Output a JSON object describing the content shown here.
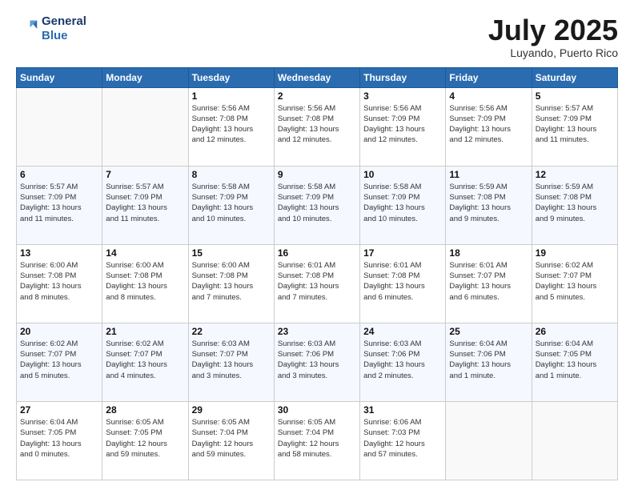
{
  "header": {
    "logo_line1": "General",
    "logo_line2": "Blue",
    "month": "July 2025",
    "location": "Luyando, Puerto Rico"
  },
  "weekdays": [
    "Sunday",
    "Monday",
    "Tuesday",
    "Wednesday",
    "Thursday",
    "Friday",
    "Saturday"
  ],
  "weeks": [
    [
      {
        "day": "",
        "info": ""
      },
      {
        "day": "",
        "info": ""
      },
      {
        "day": "1",
        "info": "Sunrise: 5:56 AM\nSunset: 7:08 PM\nDaylight: 13 hours\nand 12 minutes."
      },
      {
        "day": "2",
        "info": "Sunrise: 5:56 AM\nSunset: 7:08 PM\nDaylight: 13 hours\nand 12 minutes."
      },
      {
        "day": "3",
        "info": "Sunrise: 5:56 AM\nSunset: 7:09 PM\nDaylight: 13 hours\nand 12 minutes."
      },
      {
        "day": "4",
        "info": "Sunrise: 5:56 AM\nSunset: 7:09 PM\nDaylight: 13 hours\nand 12 minutes."
      },
      {
        "day": "5",
        "info": "Sunrise: 5:57 AM\nSunset: 7:09 PM\nDaylight: 13 hours\nand 11 minutes."
      }
    ],
    [
      {
        "day": "6",
        "info": "Sunrise: 5:57 AM\nSunset: 7:09 PM\nDaylight: 13 hours\nand 11 minutes."
      },
      {
        "day": "7",
        "info": "Sunrise: 5:57 AM\nSunset: 7:09 PM\nDaylight: 13 hours\nand 11 minutes."
      },
      {
        "day": "8",
        "info": "Sunrise: 5:58 AM\nSunset: 7:09 PM\nDaylight: 13 hours\nand 10 minutes."
      },
      {
        "day": "9",
        "info": "Sunrise: 5:58 AM\nSunset: 7:09 PM\nDaylight: 13 hours\nand 10 minutes."
      },
      {
        "day": "10",
        "info": "Sunrise: 5:58 AM\nSunset: 7:09 PM\nDaylight: 13 hours\nand 10 minutes."
      },
      {
        "day": "11",
        "info": "Sunrise: 5:59 AM\nSunset: 7:08 PM\nDaylight: 13 hours\nand 9 minutes."
      },
      {
        "day": "12",
        "info": "Sunrise: 5:59 AM\nSunset: 7:08 PM\nDaylight: 13 hours\nand 9 minutes."
      }
    ],
    [
      {
        "day": "13",
        "info": "Sunrise: 6:00 AM\nSunset: 7:08 PM\nDaylight: 13 hours\nand 8 minutes."
      },
      {
        "day": "14",
        "info": "Sunrise: 6:00 AM\nSunset: 7:08 PM\nDaylight: 13 hours\nand 8 minutes."
      },
      {
        "day": "15",
        "info": "Sunrise: 6:00 AM\nSunset: 7:08 PM\nDaylight: 13 hours\nand 7 minutes."
      },
      {
        "day": "16",
        "info": "Sunrise: 6:01 AM\nSunset: 7:08 PM\nDaylight: 13 hours\nand 7 minutes."
      },
      {
        "day": "17",
        "info": "Sunrise: 6:01 AM\nSunset: 7:08 PM\nDaylight: 13 hours\nand 6 minutes."
      },
      {
        "day": "18",
        "info": "Sunrise: 6:01 AM\nSunset: 7:07 PM\nDaylight: 13 hours\nand 6 minutes."
      },
      {
        "day": "19",
        "info": "Sunrise: 6:02 AM\nSunset: 7:07 PM\nDaylight: 13 hours\nand 5 minutes."
      }
    ],
    [
      {
        "day": "20",
        "info": "Sunrise: 6:02 AM\nSunset: 7:07 PM\nDaylight: 13 hours\nand 5 minutes."
      },
      {
        "day": "21",
        "info": "Sunrise: 6:02 AM\nSunset: 7:07 PM\nDaylight: 13 hours\nand 4 minutes."
      },
      {
        "day": "22",
        "info": "Sunrise: 6:03 AM\nSunset: 7:07 PM\nDaylight: 13 hours\nand 3 minutes."
      },
      {
        "day": "23",
        "info": "Sunrise: 6:03 AM\nSunset: 7:06 PM\nDaylight: 13 hours\nand 3 minutes."
      },
      {
        "day": "24",
        "info": "Sunrise: 6:03 AM\nSunset: 7:06 PM\nDaylight: 13 hours\nand 2 minutes."
      },
      {
        "day": "25",
        "info": "Sunrise: 6:04 AM\nSunset: 7:06 PM\nDaylight: 13 hours\nand 1 minute."
      },
      {
        "day": "26",
        "info": "Sunrise: 6:04 AM\nSunset: 7:05 PM\nDaylight: 13 hours\nand 1 minute."
      }
    ],
    [
      {
        "day": "27",
        "info": "Sunrise: 6:04 AM\nSunset: 7:05 PM\nDaylight: 13 hours\nand 0 minutes."
      },
      {
        "day": "28",
        "info": "Sunrise: 6:05 AM\nSunset: 7:05 PM\nDaylight: 12 hours\nand 59 minutes."
      },
      {
        "day": "29",
        "info": "Sunrise: 6:05 AM\nSunset: 7:04 PM\nDaylight: 12 hours\nand 59 minutes."
      },
      {
        "day": "30",
        "info": "Sunrise: 6:05 AM\nSunset: 7:04 PM\nDaylight: 12 hours\nand 58 minutes."
      },
      {
        "day": "31",
        "info": "Sunrise: 6:06 AM\nSunset: 7:03 PM\nDaylight: 12 hours\nand 57 minutes."
      },
      {
        "day": "",
        "info": ""
      },
      {
        "day": "",
        "info": ""
      }
    ]
  ]
}
